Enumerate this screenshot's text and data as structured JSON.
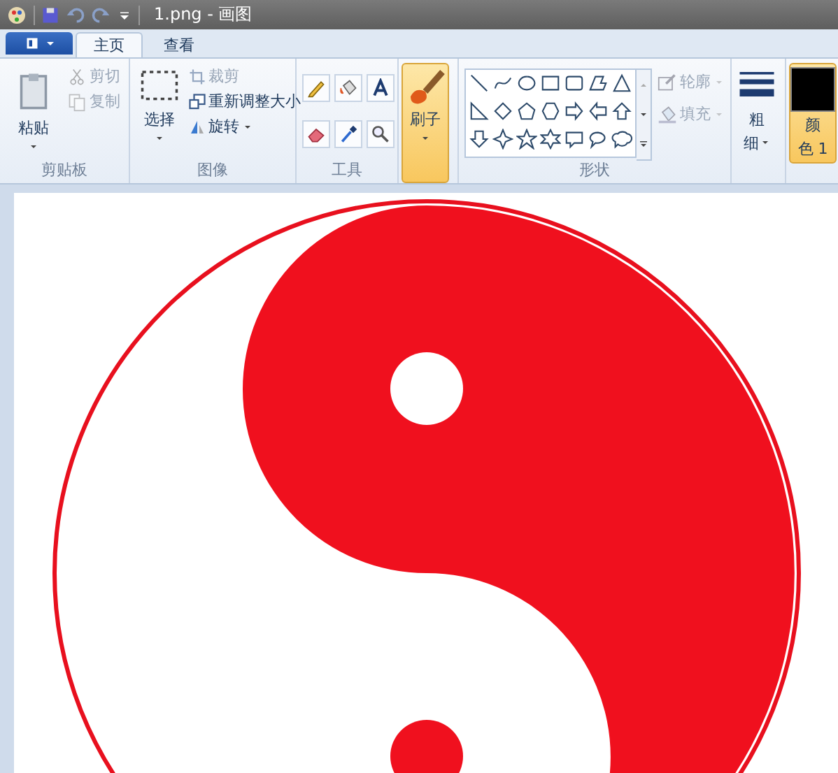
{
  "window": {
    "title": "1.png - 画图"
  },
  "tabs": [
    {
      "label": "主页",
      "selected": true
    },
    {
      "label": "查看",
      "selected": false
    }
  ],
  "clipboard": {
    "paste": "粘贴",
    "cut": {
      "label": "剪切",
      "disabled": true
    },
    "copy": {
      "label": "复制",
      "disabled": true
    },
    "group_label": "剪贴板"
  },
  "image": {
    "select": "选择",
    "crop": {
      "label": "裁剪",
      "disabled": true
    },
    "resize": {
      "label": "重新调整大小",
      "disabled": false
    },
    "rotate": {
      "label": "旋转",
      "disabled": false
    },
    "group_label": "图像"
  },
  "tools": {
    "group_label": "工具"
  },
  "brushes": {
    "label": "刷子",
    "selected": true
  },
  "shapes": {
    "group_label": "形状",
    "outline": {
      "label": "轮廓",
      "disabled": true
    },
    "fill": {
      "label": "填充",
      "disabled": true
    }
  },
  "size": {
    "label_top": "粗",
    "label_bottom": "细"
  },
  "color1": {
    "label_top": "颜",
    "label_bottom": "色 1",
    "selected": true
  }
}
